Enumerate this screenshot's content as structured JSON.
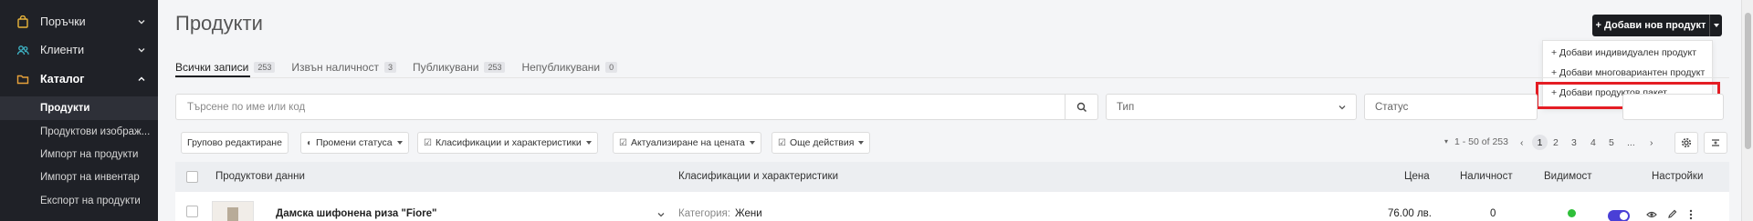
{
  "sidebar": {
    "items": [
      {
        "label": "Поръчки",
        "icon": "shopping-bag-icon"
      },
      {
        "label": "Клиенти",
        "icon": "users-icon"
      },
      {
        "label": "Каталог",
        "icon": "folder-icon"
      }
    ],
    "catalog_sub": [
      {
        "label": "Продукти"
      },
      {
        "label": "Продуктови изображ..."
      },
      {
        "label": "Импорт на продукти"
      },
      {
        "label": "Импорт на инвентар"
      },
      {
        "label": "Експорт на продукти"
      }
    ]
  },
  "header": {
    "title": "Продукти",
    "add_button": "+ Добави нов продукт"
  },
  "dropdown": {
    "items": [
      {
        "label": "+ Добави индивидуален продукт"
      },
      {
        "label": "+ Добави многовариантен продукт"
      },
      {
        "label": "+ Добави продуктов пакет"
      }
    ]
  },
  "tabs": [
    {
      "label": "Всички записи",
      "count": "253"
    },
    {
      "label": "Извън наличност",
      "count": "3"
    },
    {
      "label": "Публикувани",
      "count": "253"
    },
    {
      "label": "Непубликувани",
      "count": "0"
    }
  ],
  "filters": {
    "search_placeholder": "Търсене по име или код",
    "type_label": "Тип",
    "status_label": "Статус"
  },
  "toolbar": {
    "bulk_edit": "Групово редактиране",
    "change_status": "Промени статуса",
    "classifications": "Класификации и характеристики",
    "price_update": "Актуализиране на цената",
    "more_actions": "Още действия"
  },
  "pager": {
    "range": "1 - 50 of 253",
    "pages": [
      "1",
      "2",
      "3",
      "4",
      "5",
      "..."
    ]
  },
  "table": {
    "headers": {
      "product_data": "Продуктови данни",
      "classifications": "Класификации и характеристики",
      "price": "Цена",
      "quantity": "Наличност",
      "visibility": "Видимост",
      "settings": "Настройки"
    },
    "rows": [
      {
        "name": "Дамска шифонена риза \"Fiore\"",
        "category_label": "Категория:",
        "category_value": "Жени",
        "price": "76.00 лв.",
        "quantity": "0",
        "visibility_color": "#2fbf39",
        "toggle_color": "#4a3fd6"
      }
    ]
  },
  "colors": {
    "accent": "#1b1d21",
    "highlight": "#e41d24",
    "sidebar": "#1f2127",
    "catalog_icon": "#e8a23a",
    "orders_icon": "#e8b43a",
    "clients_icon": "#3fb6c8"
  }
}
